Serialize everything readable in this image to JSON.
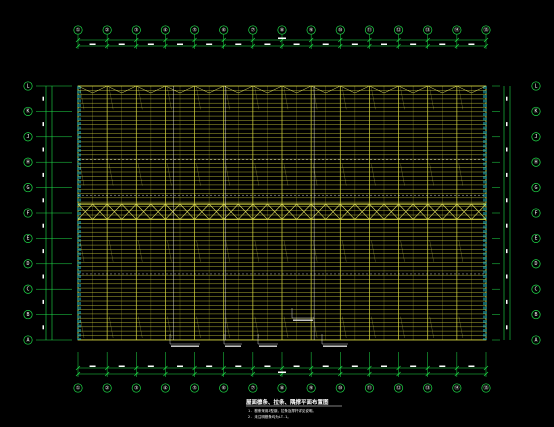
{
  "drawing": {
    "background": "#000000",
    "colors": {
      "axis_line": "#1fe04a",
      "bubble": "#1fe04a",
      "dimension": "#1fe04a",
      "purlin": "#d8d840",
      "brace": "#e0e060",
      "column": "#25d6e6",
      "text": "#ffffff"
    },
    "top_axes": [
      "①",
      "②",
      "③",
      "④",
      "⑤",
      "⑥",
      "⑦",
      "⑧",
      "⑨",
      "⑩",
      "⑪",
      "⑫",
      "⑬",
      "⑭",
      "⑮"
    ],
    "bottom_axes": [
      "①",
      "②",
      "③",
      "④",
      "⑤",
      "⑥",
      "⑦",
      "⑧",
      "⑨",
      "⑩",
      "⑪",
      "⑫",
      "⑬",
      "⑭",
      "⑮"
    ],
    "left_axes": [
      "L",
      "K",
      "J",
      "H",
      "G",
      "F",
      "E",
      "D",
      "C",
      "B",
      "A"
    ],
    "right_axes": [
      "L",
      "K",
      "J",
      "H",
      "G",
      "F",
      "E",
      "D",
      "C",
      "B",
      "A"
    ],
    "title": "屋面檩条、拉条、隅撑平面布置图",
    "note_line_1": "1. 檩条采用Z型钢，拉条及撑杆详见说明。",
    "note_line_2": "2. 未注明檩条均为LT-1。"
  }
}
